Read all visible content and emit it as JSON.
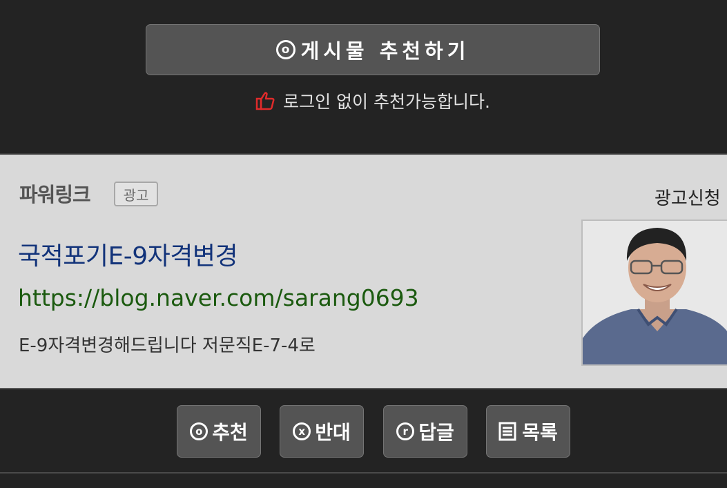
{
  "recommend": {
    "icon": "o",
    "label": "게시물 추천하기"
  },
  "note": {
    "icon": "thumbs-up-icon",
    "text": "로그인 없이 추천가능합니다."
  },
  "ad": {
    "powerlink": "파워링크",
    "badge": "광고",
    "apply": "광고신청",
    "title": "국적포기E-9자격변경",
    "url": "https://blog.naver.com/sarang0693",
    "description": "E-9자격변경해드립니다 저문직E-7-4로"
  },
  "actions": [
    {
      "icon": "o",
      "label": "추천"
    },
    {
      "icon": "x",
      "label": "반대"
    },
    {
      "icon": "r",
      "label": "답글"
    },
    {
      "icon": "list-icon",
      "label": "목록"
    }
  ],
  "colors": {
    "background": "#232323",
    "button": "#545454",
    "ad_background": "#d9d9d9",
    "ad_title": "#12337a",
    "ad_url": "#1b5a0f",
    "thumb_icon": "#e02b2b"
  }
}
